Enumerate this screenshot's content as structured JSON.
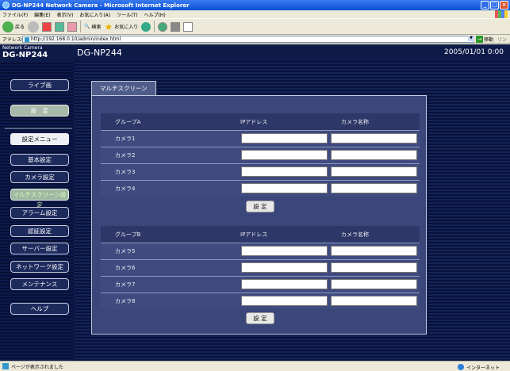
{
  "window": {
    "title": "DG-NP244 Network Camera - Microsoft Internet Explorer"
  },
  "menu": [
    "ファイル(F)",
    "編集(E)",
    "表示(V)",
    "お気に入り(A)",
    "ツール(T)",
    "ヘルプ(H)"
  ],
  "toolbar": {
    "back_label": "戻る",
    "search_label": "検索",
    "favorites_label": "お気に入り"
  },
  "address": {
    "label": "アドレス(D)",
    "url": "http://192.168.0.10/admin/index.html",
    "go_label": "移動",
    "links_label": "リンク"
  },
  "camera_header": {
    "brand": "Network Camera",
    "model": "DG-NP244",
    "page_title": "DG-NP244",
    "datetime": "2005/01/01  0:00"
  },
  "sidebar": {
    "live": "ライブ画",
    "setup": "設　定",
    "menu_heading": "設定メニュー",
    "items": [
      "基本設定",
      "カメラ設定",
      "マルチスクリーン設定",
      "アラーム設定",
      "認証設定",
      "サーバー設定",
      "ネットワーク設定",
      "メンテナンス"
    ],
    "help": "ヘルプ"
  },
  "tab": {
    "label": "マルチスクリーン"
  },
  "groups": [
    {
      "name": "グループA",
      "ip_header": "IPアドレス",
      "cam_header": "カメラ名称",
      "cameras": [
        {
          "label": "カメラ1",
          "ip": "",
          "name": ""
        },
        {
          "label": "カメラ2",
          "ip": "",
          "name": ""
        },
        {
          "label": "カメラ3",
          "ip": "",
          "name": ""
        },
        {
          "label": "カメラ4",
          "ip": "",
          "name": ""
        }
      ],
      "button": "設 定"
    },
    {
      "name": "グループB",
      "ip_header": "IPアドレス",
      "cam_header": "カメラ名称",
      "cameras": [
        {
          "label": "カメラ5",
          "ip": "",
          "name": ""
        },
        {
          "label": "カメラ6",
          "ip": "",
          "name": ""
        },
        {
          "label": "カメラ7",
          "ip": "",
          "name": ""
        },
        {
          "label": "カメラ8",
          "ip": "",
          "name": ""
        }
      ],
      "button": "設 定"
    }
  ],
  "status": {
    "message": "ページが表示されました",
    "zone": "インターネット"
  }
}
